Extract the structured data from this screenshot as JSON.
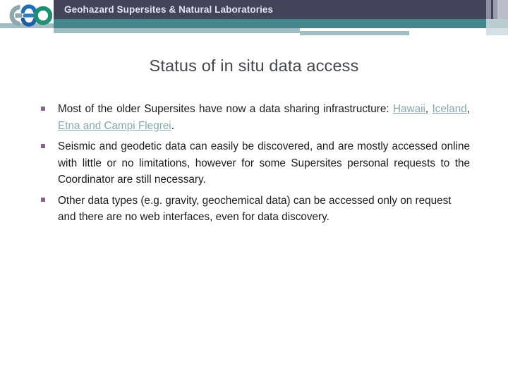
{
  "header": {
    "title": "Geohazard Supersites & Natural Laboratories",
    "logo_alt": "GEO",
    "logo_letters": [
      "G",
      "E",
      "O"
    ],
    "colors": {
      "dark_bar": "#43445a",
      "teal_band": "#44848b",
      "light_band": "#9fbdc2",
      "title_text": "#e2e3ef"
    }
  },
  "slide": {
    "title": "Status of in situ data access",
    "title_color": "#45474f",
    "bullet_marker": "§",
    "bullet_color": "#8d5f92",
    "link_color": "#86a9b0",
    "bullets": [
      {
        "id": "bullet-1",
        "lead": "Most of the older Supersites have now a data sharing infrastructure: ",
        "links": [
          {
            "label": "Hawaii",
            "after": ", "
          },
          {
            "label": "Iceland",
            "after": ", "
          },
          {
            "label": "Etna and Campi Flegrei",
            "after": "."
          }
        ],
        "full_text": "Most of the older Supersites have now a data sharing infrastructure: Hawaii, Iceland, Etna and Campi Flegrei."
      },
      {
        "id": "bullet-2",
        "text": "Seismic and geodetic data can easily be discovered, and are mostly accessed online with little or no limitations, however for some Supersites personal requests to the Coordinator are still necessary."
      },
      {
        "id": "bullet-3",
        "text": "Other data types (e.g. gravity, geochemical data) can be accessed only on request and there are no web interfaces, even for data discovery."
      }
    ]
  }
}
